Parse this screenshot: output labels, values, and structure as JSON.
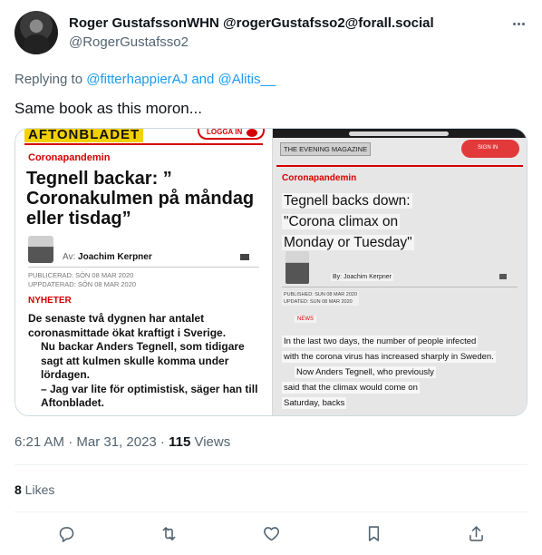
{
  "tweet": {
    "display_name": "Roger GustafssonWHN @rogerGustafsso2@forall.social",
    "handle": "@RogerGustafsso2",
    "reply_prefix": "Replying to",
    "reply_mention_1": "@fitterhappierAJ",
    "reply_and": "and",
    "reply_mention_2": "@Alitis__",
    "text": "Same book as this moron...",
    "time": "6:21 AM · Mar 31, 2023 · ",
    "views_count": "115",
    "views_label": " Views",
    "likes_count": "8",
    "likes_label": " Likes"
  },
  "media_left": {
    "logo": "AFTONBLADET",
    "login": "LOGGA IN",
    "kicker": "Coronapandemin",
    "headline": "Tegnell backar: ” Coronakulmen på måndag eller tisdag”",
    "author_prefix": "Av: ",
    "author": "Joachim Kerpner",
    "published": "PUBLICERAD: SÖN 08 MAR 2020",
    "updated": "UPPDATERAD: SÖN 08 MAR 2020",
    "section": "NYHETER",
    "body_1": "De senaste två dygnen har antalet coronasmittade ökat kraftigt i Sverige.",
    "body_2": "Nu backar Anders Tegnell, som tidigare sagt att kulmen skulle komma under lördagen.",
    "body_3": "– Jag var lite för optimistisk, säger han till Aftonbladet."
  },
  "media_right": {
    "magazine": "THE EVENING MAGAZINE",
    "signin": "SIGN IN",
    "kicker": "Coronapandemin",
    "headline_1": "Tegnell backs down:",
    "headline_2": "\"Corona climax on",
    "headline_3": "Monday or Tuesday\"",
    "author": "By: Joachim Kerpner",
    "published": "PUBLISHED: SUN 08 MAR 2020",
    "updated": "UPDATED: SUN 08 MAR 2020",
    "section": "NEWS",
    "body_1": "In the last two days, the number of people infected",
    "body_2": "with the corona virus has increased sharply in Sweden.",
    "body_3": "Now Anders Tegnell, who previously",
    "body_4": "said that the climax would come on",
    "body_5": "Saturday, backs"
  },
  "icons": {
    "more": "more-dots-icon",
    "reply": "reply-icon",
    "retweet": "retweet-icon",
    "like": "heart-icon",
    "bookmark": "bookmark-icon",
    "share": "share-icon"
  },
  "colors": {
    "link": "#1d9bf0",
    "secondary_text": "#536471",
    "primary_text": "#0f1419",
    "newspaper_red": "#d50000"
  }
}
